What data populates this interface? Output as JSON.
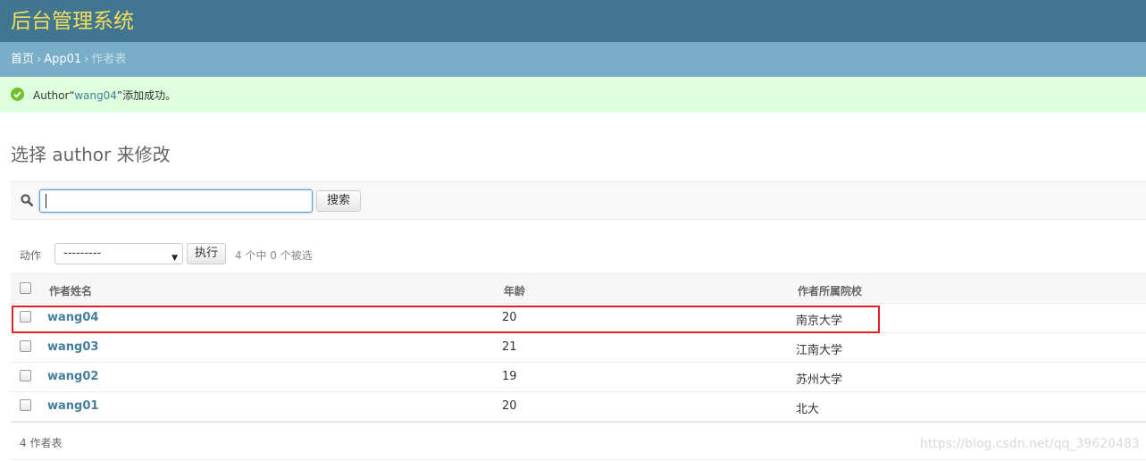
{
  "header": {
    "title": "后台管理系统"
  },
  "breadcrumbs": {
    "home": "首页",
    "app": "App01",
    "current": "作者表",
    "separator": "›"
  },
  "message": {
    "prefix": "Author“",
    "link": "wang04",
    "suffix": "”添加成功。"
  },
  "page": {
    "title": "选择 author 来修改"
  },
  "search": {
    "value": "",
    "button": "搜索"
  },
  "actions": {
    "label": "动作",
    "selected": "---------",
    "go_button": "执行",
    "counter": "4 个中 0 个被选"
  },
  "table": {
    "headers": [
      "作者姓名",
      "年龄",
      "作者所属院校"
    ],
    "rows": [
      {
        "name": "wang04",
        "age": "20",
        "school": "南京大学"
      },
      {
        "name": "wang03",
        "age": "21",
        "school": "江南大学"
      },
      {
        "name": "wang02",
        "age": "19",
        "school": "苏州大学"
      },
      {
        "name": "wang01",
        "age": "20",
        "school": "北大"
      }
    ]
  },
  "paginator": {
    "text": "4 作者表"
  },
  "watermark": "https://blog.csdn.net/qq_39620483",
  "colors": {
    "header": "#417690",
    "branding": "#f5dd5d",
    "breadcrumbs": "#79aec8",
    "success": "#dfd",
    "link": "#447e9b",
    "highlight": "#e02020"
  }
}
